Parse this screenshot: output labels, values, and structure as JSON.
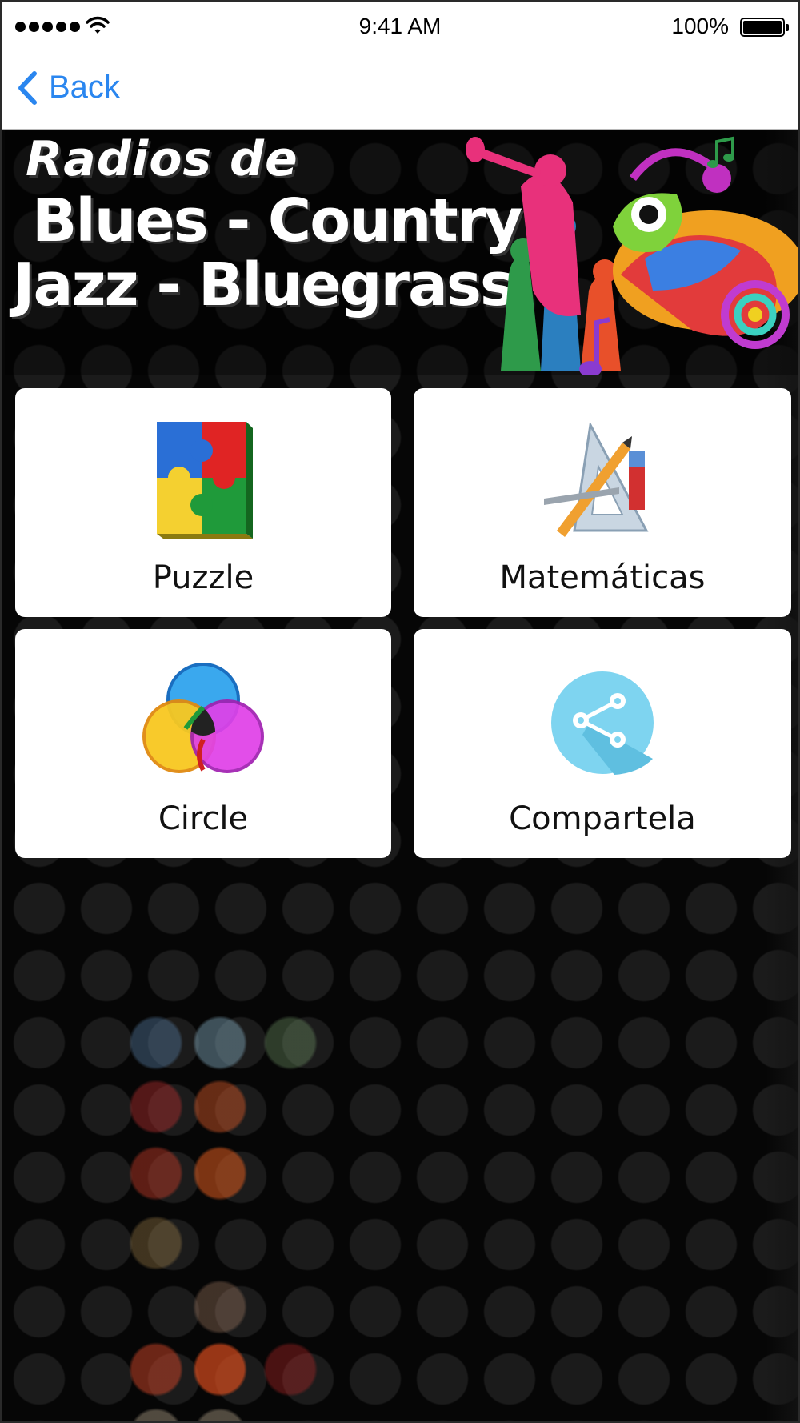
{
  "status_bar": {
    "time": "9:41 AM",
    "battery_percent": "100%",
    "battery_level": 1.0,
    "signal_bars": 5
  },
  "nav": {
    "back_label": "Back"
  },
  "banner": {
    "line1": "Radios de",
    "line2": "Blues - Country",
    "line3": "Jazz - Bluegrass"
  },
  "menu": [
    {
      "label": "Puzzle",
      "icon": "puzzle-icon"
    },
    {
      "label": "Matemáticas",
      "icon": "math-tools-icon"
    },
    {
      "label": "Circle",
      "icon": "color-circles-icon"
    },
    {
      "label": "Compartela",
      "icon": "share-icon"
    }
  ],
  "colors": {
    "accent": "#2a86ef",
    "background": "#060606",
    "card": "#ffffff"
  }
}
